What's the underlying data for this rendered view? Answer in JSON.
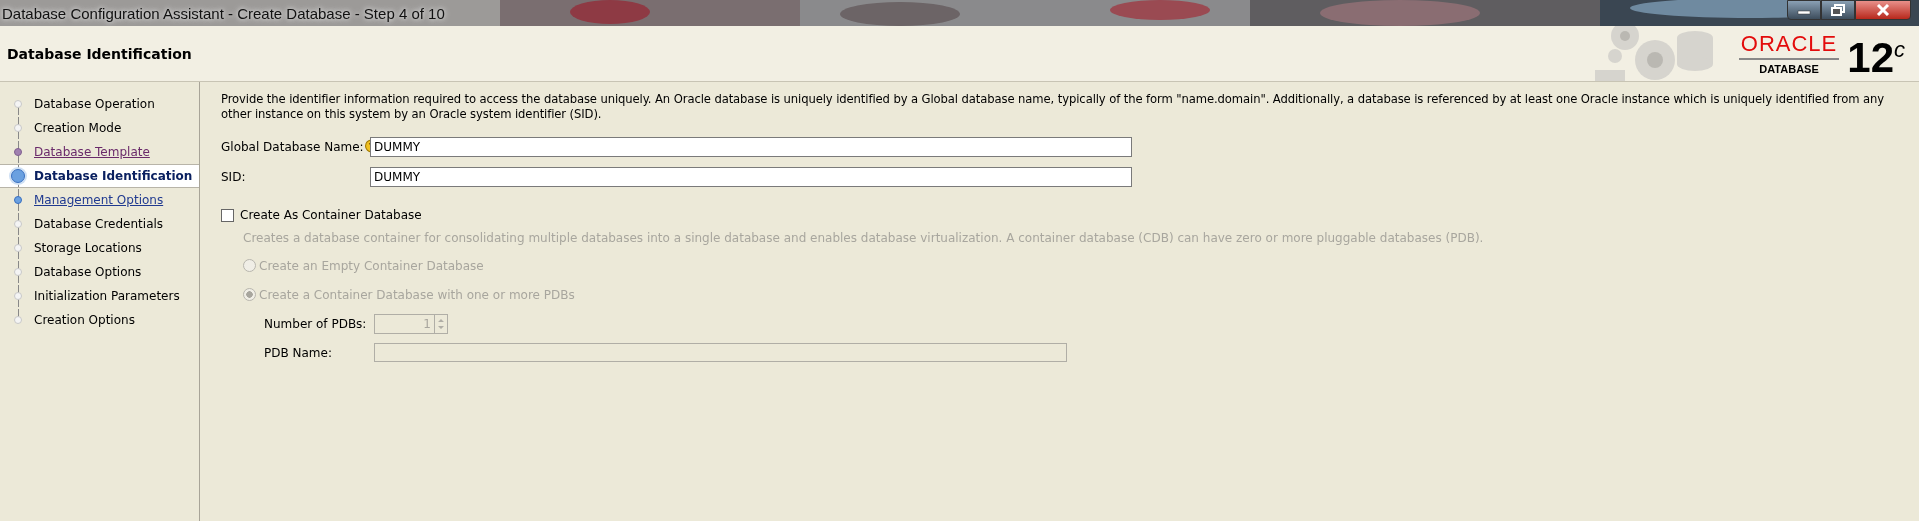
{
  "window": {
    "title": "Database Configuration Assistant - Create Database - Step 4 of 10"
  },
  "header": {
    "title": "Database Identification",
    "logo": {
      "brand": "ORACLE",
      "product": "DATABASE",
      "version": "12$^{c}$"
    }
  },
  "steps": [
    {
      "label": "Database Operation",
      "kind": "plain",
      "selected": false
    },
    {
      "label": "Creation Mode",
      "kind": "plain",
      "selected": false
    },
    {
      "label": "Database Template",
      "kind": "visited",
      "selected": false
    },
    {
      "label": "Database Identification",
      "kind": "plain",
      "selected": true
    },
    {
      "label": "Management Options",
      "kind": "link",
      "selected": false
    },
    {
      "label": "Database Credentials",
      "kind": "plain",
      "selected": false
    },
    {
      "label": "Storage Locations",
      "kind": "plain",
      "selected": false
    },
    {
      "label": "Database Options",
      "kind": "plain",
      "selected": false
    },
    {
      "label": "Initialization Parameters",
      "kind": "plain",
      "selected": false
    },
    {
      "label": "Creation Options",
      "kind": "plain",
      "selected": false
    }
  ],
  "form": {
    "description": "Provide the identifier information required to access the database uniquely. An Oracle database is uniquely identified by a Global database name, typically of the form \"name.domain\". Additionally, a database is referenced by at least one Oracle instance which is uniquely identified from any other instance on this system by an Oracle system identifier (SID).",
    "fields": [
      {
        "label": "Global Database Name:",
        "value": "DUMMY",
        "help": true
      },
      {
        "label": "SID:",
        "value": "DUMMY",
        "help": false
      }
    ]
  },
  "container": {
    "label": "Create As Container Database",
    "checked": false,
    "disabled": true,
    "description": "Creates a database container for consolidating multiple databases into a single database and enables database virtualization. A container database (CDB) can have zero or more pluggable databases (PDB).",
    "options": [
      {
        "label": "Create an Empty Container Database",
        "selected": false
      },
      {
        "label": "Create a Container Database with one or more PDBs",
        "selected": true
      }
    ],
    "pdb_count": {
      "label": "Number of PDBs:",
      "value": "1"
    },
    "pdb_name": {
      "label": "PDB Name:"
    }
  }
}
